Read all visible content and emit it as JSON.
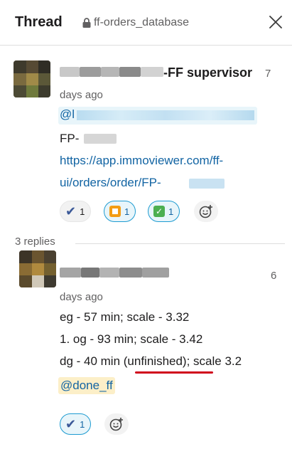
{
  "header": {
    "title": "Thread",
    "channel": "ff-orders_database",
    "close_icon": "close-icon",
    "lock_icon": "lock-icon"
  },
  "messages": [
    {
      "author_suffix": "-FF supervisor",
      "timestamp_a": "7",
      "timestamp_b": "days ago",
      "mention_prefix": "@l",
      "line1_prefix": "FP-",
      "link_line1": "https://app.immoviewer.com/ff-",
      "link_line2": "ui/orders/order/FP-",
      "reactions": [
        {
          "icon": "heavy-check-mark-icon",
          "count": "1"
        },
        {
          "icon": "orange-square-icon",
          "count": "1"
        },
        {
          "icon": "white-check-mark-icon",
          "count": "1"
        }
      ],
      "add_reaction_icon": "add-reaction-icon"
    },
    {
      "timestamp_a": "6",
      "timestamp_b": "days ago",
      "lines": [
        "eg - 57 min; scale - 3.32",
        "1. og - 93 min; scale - 3.42"
      ],
      "line3_a": "dg - 40 min ",
      "line3_b": "(unfinished)",
      "line3_c": "; scale 3.2",
      "mention": "@done_ff",
      "reactions": [
        {
          "icon": "heavy-check-mark-icon",
          "count": "1"
        }
      ],
      "add_reaction_icon": "add-reaction-icon"
    }
  ],
  "replies_label": "3 replies",
  "colors": {
    "link": "#1264a3",
    "mention_bg": "#e8f5fa",
    "mention_yellow_bg": "#fcefc8",
    "active_reaction_border": "#1d9bd1",
    "annotation_red": "#d0021b"
  }
}
